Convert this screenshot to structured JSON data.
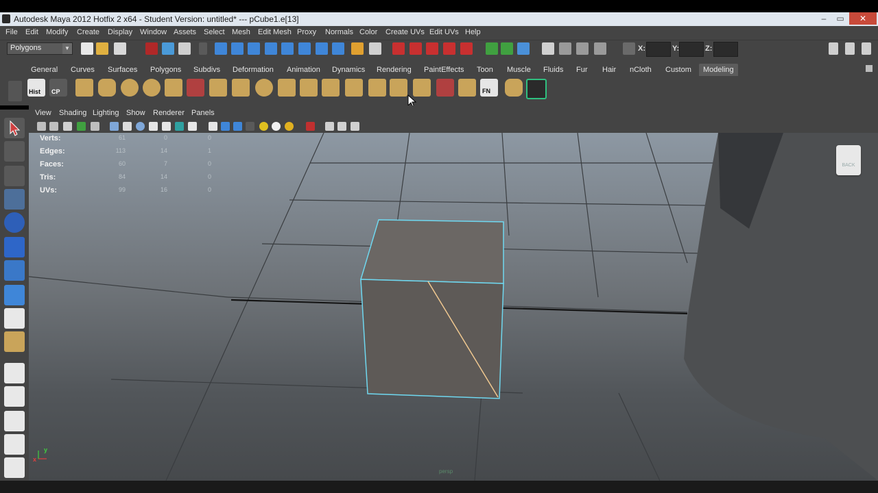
{
  "window": {
    "title": "Autodesk Maya 2012 Hotfix 2 x64 - Student Version: untitled*   ---   pCube1.e[13]",
    "minimize_glyph": "–",
    "maximize_glyph": "▭",
    "close_glyph": "✕"
  },
  "menubar": {
    "items": [
      "File",
      "Edit",
      "Modify",
      "Create",
      "Display",
      "Window",
      "Assets",
      "Select",
      "Mesh",
      "Edit Mesh",
      "Proxy",
      "Normals",
      "Color",
      "Create UVs",
      "Edit UVs",
      "Help"
    ]
  },
  "statusline": {
    "mode": "Polygons",
    "x_label": "X:",
    "y_label": "Y:",
    "z_label": "Z:",
    "x_value": "",
    "y_value": "",
    "z_value": ""
  },
  "shelf": {
    "tabs": [
      "General",
      "Curves",
      "Surfaces",
      "Polygons",
      "Subdivs",
      "Deformation",
      "Animation",
      "Dynamics",
      "Rendering",
      "PaintEffects",
      "Toon",
      "Muscle",
      "Fluids",
      "Fur",
      "Hair",
      "nCloth",
      "Custom",
      "Modeling"
    ],
    "active_tab": "Modeling",
    "hist_label": "Hist",
    "cp_label": "CP",
    "fn_label": "FN"
  },
  "panel": {
    "menu": [
      "View",
      "Shading",
      "Lighting",
      "Show",
      "Renderer",
      "Panels"
    ]
  },
  "hud": {
    "rows": [
      {
        "label": "Verts:",
        "v1": "61",
        "v2": "0",
        "v3": "0"
      },
      {
        "label": "Edges:",
        "v1": "113",
        "v2": "14",
        "v3": "1"
      },
      {
        "label": "Faces:",
        "v1": "60",
        "v2": "7",
        "v3": "0"
      },
      {
        "label": "Tris:",
        "v1": "84",
        "v2": "14",
        "v3": "0"
      },
      {
        "label": "UVs:",
        "v1": "99",
        "v2": "16",
        "v3": "0"
      }
    ]
  },
  "viewcube": {
    "face": "BACK"
  },
  "viewport": {
    "camera_label": "persp"
  },
  "axis": {
    "x": "x",
    "y": "y"
  },
  "colors": {
    "selection": "#6fd8f0",
    "highlight_edge": "#f0c890",
    "ui_bg": "#444444"
  }
}
